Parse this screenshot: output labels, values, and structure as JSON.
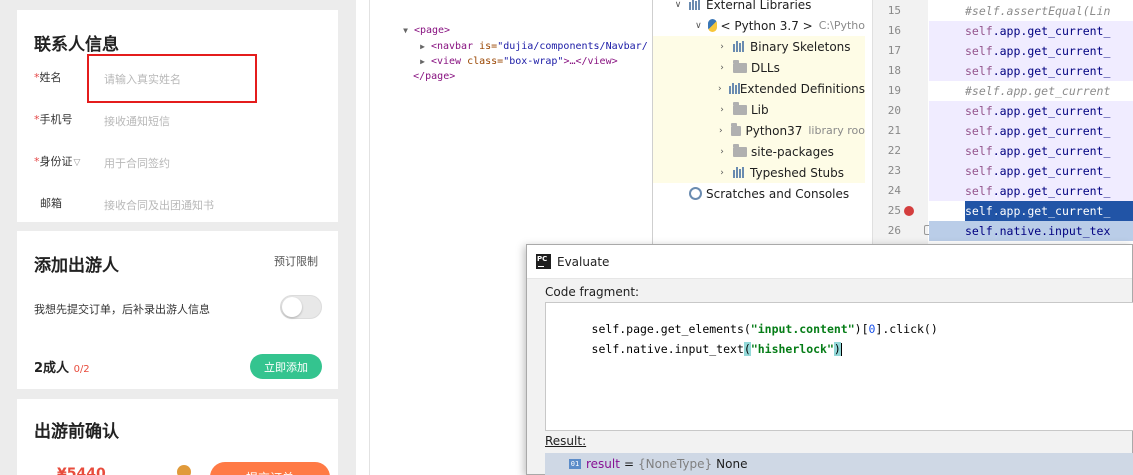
{
  "mobile": {
    "contact_card": {
      "title": "联系人信息",
      "fields": [
        {
          "required": "*",
          "label": "姓名",
          "placeholder": "请输入真实姓名"
        },
        {
          "required": "*",
          "label": "手机号",
          "placeholder": "接收通知短信"
        },
        {
          "required": "*",
          "label": "身份证",
          "chevron": "▽",
          "placeholder": "用于合同签约"
        },
        {
          "required": "",
          "label": "邮箱",
          "placeholder": "接收合同及出团通知书"
        }
      ]
    },
    "travelers_card": {
      "title": "添加出游人",
      "booking_limit": "预订限制",
      "toggle_text": "我想先提交订单，后补录出游人信息",
      "adults_label": "2成人",
      "adults_count": "0/2",
      "add_button": "立即添加"
    },
    "confirm_card": {
      "title": "出游前确认",
      "price": "¥5440",
      "submit": "提交订单"
    }
  },
  "dom_tree": {
    "page_open": "<page>",
    "navbar": {
      "tag": "<navbar",
      "attr": " is=",
      "value": "\"dujia/components/Navbar/"
    },
    "view": {
      "tag": "<view",
      "attr": " class=",
      "value": "\"box-wrap\"",
      "rest": ">…</view>"
    },
    "page_close": "</page>"
  },
  "project_tree": [
    {
      "label": "External Libraries",
      "arrow": "∨",
      "indent": 0,
      "icon": "library-icon"
    },
    {
      "label": "< Python 3.7 >",
      "extra": "C:\\Pytho",
      "arrow": "∨",
      "indent": 1,
      "icon": "python-icon"
    },
    {
      "label": "Binary Skeletons",
      "arrow": "›",
      "indent": 2,
      "icon": "library-icon"
    },
    {
      "label": "DLLs",
      "arrow": "›",
      "indent": 2,
      "icon": "folder-icon"
    },
    {
      "label": "Extended Definitions",
      "arrow": "›",
      "indent": 2,
      "icon": "library-icon"
    },
    {
      "label": "Lib",
      "arrow": "›",
      "indent": 2,
      "icon": "folder-icon"
    },
    {
      "label": "Python37",
      "extra": "library roo",
      "arrow": "›",
      "indent": 2,
      "icon": "folder-icon"
    },
    {
      "label": "site-packages",
      "arrow": "›",
      "indent": 2,
      "icon": "folder-icon"
    },
    {
      "label": "Typeshed Stubs",
      "arrow": "›",
      "indent": 2,
      "icon": "library-icon"
    },
    {
      "label": "Scratches and Consoles",
      "arrow": "",
      "indent": 0,
      "icon": "scratch-icon"
    }
  ],
  "gutter": {
    "line_numbers": [
      "15",
      "16",
      "17",
      "18",
      "19",
      "20",
      "21",
      "22",
      "23",
      "24",
      "25",
      "26"
    ],
    "breakpoint_line": "25"
  },
  "code_lines": [
    {
      "kind": "comment",
      "text": "#self.assertEqual(Lin"
    },
    {
      "kind": "call",
      "self": "self",
      "rest": ".app.get_current_"
    },
    {
      "kind": "call",
      "self": "self",
      "rest": ".app.get_current_"
    },
    {
      "kind": "call",
      "self": "self",
      "rest": ".app.get_current_"
    },
    {
      "kind": "comment",
      "text": "#self.app.get_current"
    },
    {
      "kind": "call",
      "self": "self",
      "rest": ".app.get_current_"
    },
    {
      "kind": "call",
      "self": "self",
      "rest": ".app.get_current_"
    },
    {
      "kind": "call",
      "self": "self",
      "rest": ".app.get_current_"
    },
    {
      "kind": "call",
      "self": "self",
      "rest": ".app.get_current_"
    },
    {
      "kind": "call",
      "self": "self",
      "rest": ".app.get_current_"
    },
    {
      "kind": "exec",
      "self": "self",
      "rest": ".app.get_current_"
    },
    {
      "kind": "selected",
      "self": "self",
      "rest": ".native.input_tex"
    }
  ],
  "evaluate": {
    "title": "Evaluate",
    "code_fragment_label": "Code fragment:",
    "line1": {
      "a": "self.page.get_elements(",
      "str": "\"input.content\"",
      "b": ")[",
      "num": "0",
      "c": "].click()"
    },
    "line2": {
      "a": "self.native.input_text",
      "p1": "(",
      "str": "\"hisherlock\"",
      "p2": ")"
    },
    "result_label": "Result:",
    "result": {
      "name": "result",
      "eq": "=",
      "type": "{NoneType}",
      "value": "None",
      "icon_text": "01"
    }
  },
  "colors": {
    "accent_green": "#34c48f",
    "required_red": "#e54848",
    "highlight_red": "#e41c1c",
    "exec_line_blue": "#2154a6",
    "breakpoint_red": "#d43e3e"
  }
}
